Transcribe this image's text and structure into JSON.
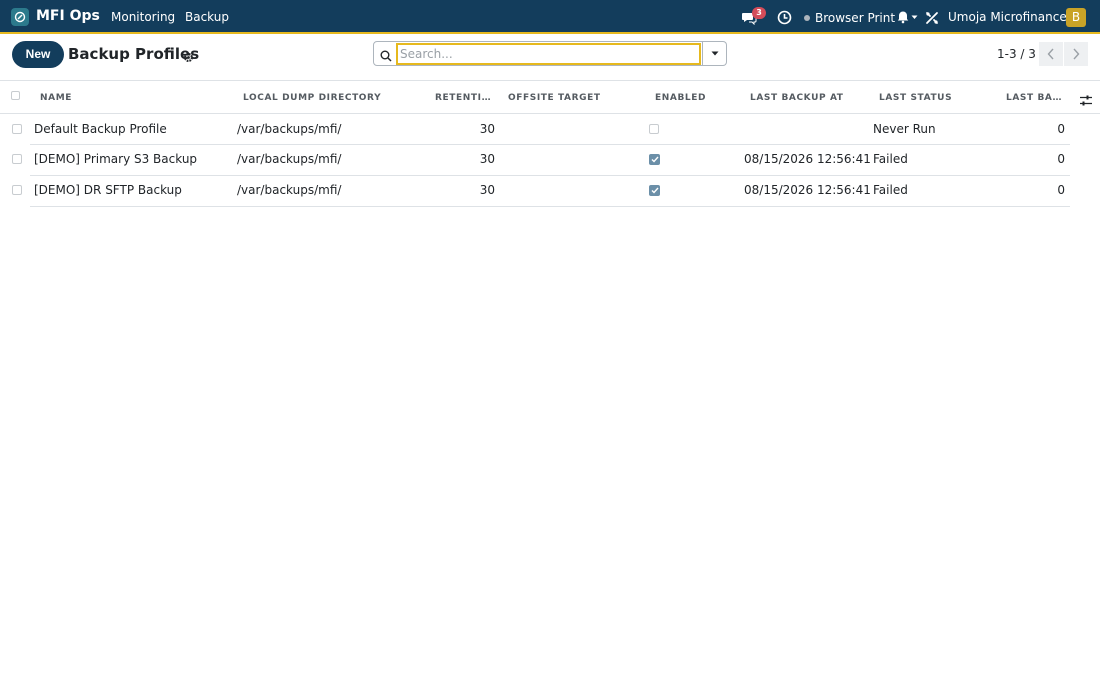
{
  "navbar": {
    "app_name": "MFI Ops",
    "menus": [
      "Monitoring",
      "Backup"
    ],
    "chat_count": "3",
    "printer_label": "Browser Print",
    "company": "Umoja Microfinance",
    "avatar_letter": "B"
  },
  "control": {
    "new_label": "New",
    "title": "Backup Profiles",
    "search_placeholder": "Search...",
    "pager": "1-3 / 3"
  },
  "table": {
    "columns": [
      "NAME",
      "LOCAL DUMP DIRECTORY",
      "RETENTI…",
      "OFFSITE TARGET",
      "ENABLED",
      "LAST BACKUP AT",
      "LAST STATUS",
      "LAST BA…"
    ],
    "rows": [
      {
        "name": "Default Backup Profile",
        "dir": "/var/backups/mfi/",
        "retention": "30",
        "offsite": "",
        "enabled": false,
        "last_backup_at": "",
        "status": "Never Run",
        "last_ba": "0"
      },
      {
        "name": "[DEMO] Primary S3 Backup",
        "dir": "/var/backups/mfi/",
        "retention": "30",
        "offsite": "",
        "enabled": true,
        "last_backup_at": "08/15/2026 12:56:41",
        "status": "Failed",
        "last_ba": "0"
      },
      {
        "name": "[DEMO] DR SFTP Backup",
        "dir": "/var/backups/mfi/",
        "retention": "30",
        "offsite": "",
        "enabled": true,
        "last_backup_at": "08/15/2026 12:56:41",
        "status": "Failed",
        "last_ba": "0"
      }
    ]
  },
  "colors": {
    "navbar": "#133d5c",
    "accent": "#e6b91e",
    "badge": "#d44c59",
    "avatar": "#c9a327"
  }
}
